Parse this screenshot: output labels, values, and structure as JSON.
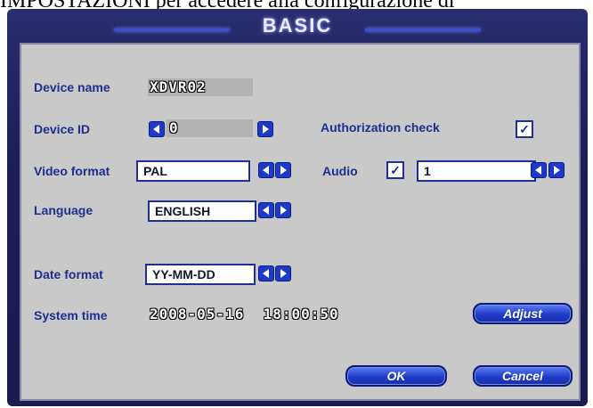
{
  "background": {
    "text": "IMPOSTAZIONI per accedere alla configurazione di"
  },
  "dialog": {
    "title": "BASIC"
  },
  "device_name": {
    "label": "Device name",
    "value": "XDVR02"
  },
  "device_id": {
    "label": "Device ID",
    "value": "0"
  },
  "authorization": {
    "label": "Authorization check",
    "checked": true,
    "mark": "✓"
  },
  "video_format": {
    "label": "Video format",
    "value": "PAL"
  },
  "audio": {
    "label": "Audio",
    "checked": true,
    "mark": "✓",
    "value": "1"
  },
  "language": {
    "label": "Language",
    "value": "ENGLISH"
  },
  "date_format": {
    "label": "Date format",
    "value": "YY-MM-DD"
  },
  "system_time": {
    "label": "System time",
    "value": "2008-05-16  18:00:50"
  },
  "buttons": {
    "adjust": "Adjust",
    "ok": "OK",
    "cancel": "Cancel"
  },
  "colors": {
    "label": "#1c2e8e",
    "panel": "#c9c9c9",
    "frame": "#1b1d55",
    "button": "#1e3cc8"
  }
}
